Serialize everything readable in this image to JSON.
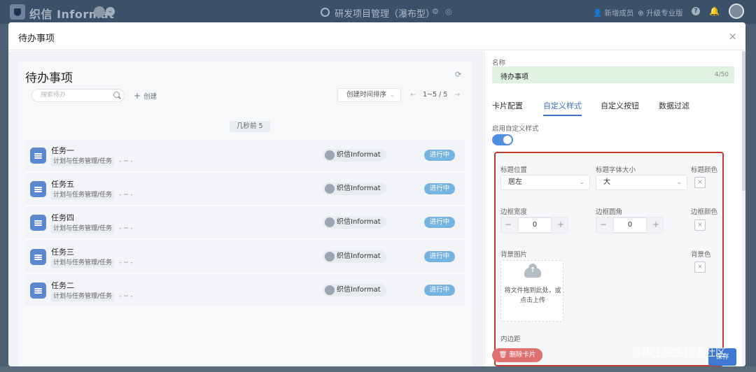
{
  "topbar": {
    "brand": "织信 Informat",
    "project_title": "研发项目管理（瀑布型）",
    "new_member": "新增成员",
    "upgrade": "升级专业版",
    "help": "?",
    "chevron": "⌄",
    "gear": "⚙",
    "dot": "◎",
    "bell": "🔔"
  },
  "modal": {
    "title": "待办事项",
    "close": "×"
  },
  "list": {
    "title": "待办事项",
    "refresh": "⟳",
    "search_placeholder": "搜索待办",
    "create_label": "创建",
    "create_plus": "+",
    "sort_label": "创建时间排序",
    "sort_chev": "⌄",
    "pager_prev": "←",
    "pager_text": "1~5 / 5",
    "pager_next": "→",
    "group": "几秒前 5",
    "tasks": [
      {
        "name": "任务一",
        "path": "计划与任务管理/任务",
        "date": "- ~ -",
        "user": "织信Informat",
        "status": "进行中"
      },
      {
        "name": "任务五",
        "path": "计划与任务管理/任务",
        "date": "- ~ -",
        "user": "织信Informat",
        "status": "进行中"
      },
      {
        "name": "任务四",
        "path": "计划与任务管理/任务",
        "date": "- ~ -",
        "user": "织信Informat",
        "status": "进行中"
      },
      {
        "name": "任务三",
        "path": "计划与任务管理/任务",
        "date": "- ~ -",
        "user": "织信Informat",
        "status": "进行中"
      },
      {
        "name": "任务二",
        "path": "计划与任务管理/任务",
        "date": "- ~ -",
        "user": "织信Informat",
        "status": "进行中"
      }
    ]
  },
  "config": {
    "name_label": "名称",
    "name_value": "待办事项",
    "name_count": "4/50",
    "tabs": [
      "卡片配置",
      "自定义样式",
      "自定义按钮",
      "数据过滤"
    ],
    "active_tab": "自定义样式",
    "enable_label": "启用自定义样式",
    "enable_on": true,
    "title_position_label": "标题位置",
    "title_position_value": "居左",
    "title_font_label": "标题字体大小",
    "title_font_value": "大",
    "title_color_label": "标题颜色",
    "border_width_label": "边框宽度",
    "border_width_value": "0",
    "border_radius_label": "边框圆角",
    "border_radius_value": "0",
    "border_color_label": "边框颜色",
    "bg_image_label": "背景图片",
    "upload_text": "将文件拖到此处，或点击上传",
    "bg_color_label": "背景色",
    "padding_label": "内边距",
    "color_placeholder": "×",
    "minus": "−",
    "plus": "+",
    "chev": "⌄",
    "delete_label": "删除卡片",
    "save_label": "保存"
  },
  "watermark": "@稀土掘金技术社区"
}
